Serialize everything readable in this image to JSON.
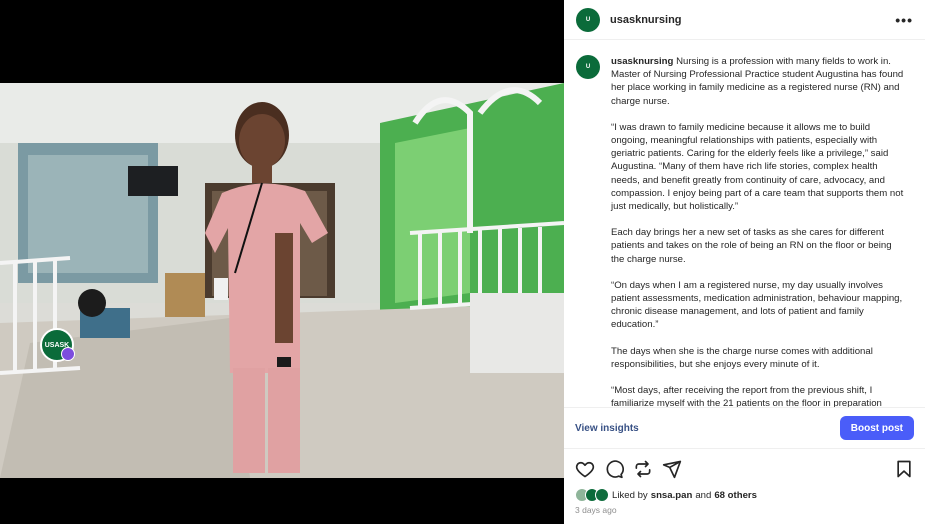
{
  "post": {
    "username": "usasknursing",
    "avatar_icon": "usask-logo-icon",
    "more_label": "•••",
    "caption_lead": "Nursing is a profession with many fields to work in. Master of Nursing Professional Practice student Augustina has found her place working in family medicine as a registered nurse (RN) and charge nurse.",
    "paragraphs": [
      "“I was drawn to family medicine because it allows me to build ongoing, meaningful relationships with patients, especially with geriatric patients. Caring for the elderly feels like a privilege,” said Augustina. “Many of them have rich life stories, complex health needs, and benefit greatly from continuity of care, advocacy, and compassion. I enjoy being part of a care team that supports them not just medically, but holistically.”",
      "Each day brings her a new set of tasks as she cares for different patients and takes on the role of being an RN on the floor or being the charge nurse.",
      "“On days when I am a registered nurse, my day usually involves patient assessments, medication administration, behaviour mapping, chronic disease management, and lots of patient and family education.”",
      "The days when she is the charge nurse comes with additional responsibilities, but she enjoys every minute of it.",
      "“Most days, after receiving the report from the previous shift, I familiarize myself with the 21 patients on the floor in preparation"
    ],
    "view_insights": "View insights",
    "boost_post": "Boost post",
    "likes_prefix": "Liked by",
    "likes_user": "snsa.pan",
    "likes_and": "and",
    "likes_others": "68 others",
    "timestamp": "3 days ago",
    "media_badge_text": "USASK"
  },
  "colors": {
    "brand_green": "#0b6b3a",
    "boost_blue": "#4a5df9",
    "insights_link": "#385185",
    "muted": "#8e8e8e"
  },
  "icons": [
    "heart-icon",
    "comment-icon",
    "repost-icon",
    "share-icon",
    "bookmark-icon"
  ]
}
